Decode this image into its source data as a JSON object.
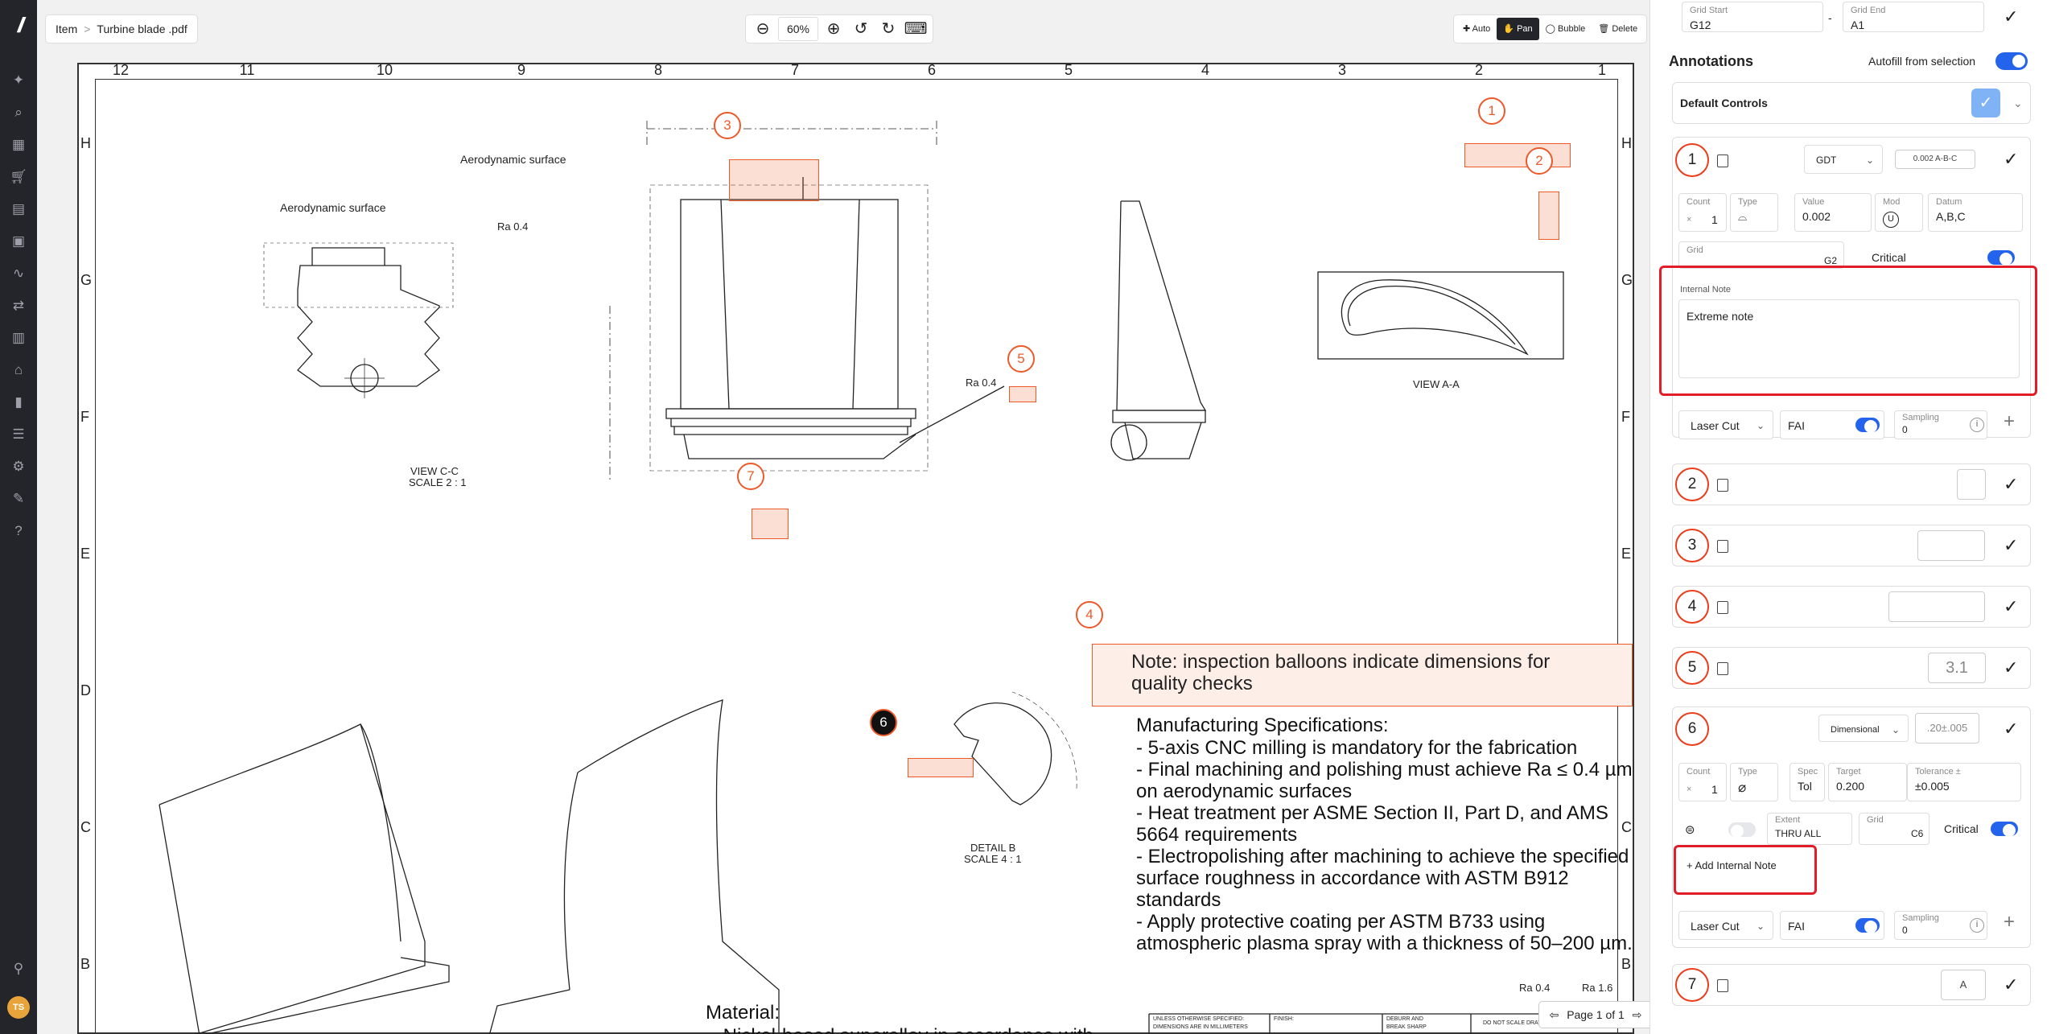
{
  "rail": {
    "logo": "//",
    "avatar": "TS"
  },
  "breadcrumb": {
    "root": "Item",
    "sep": ">",
    "file": "Turbine blade .pdf"
  },
  "zoom": {
    "value": "60%"
  },
  "modes": {
    "auto": "Auto",
    "pan": "Pan",
    "bubble": "Bubble",
    "delete": "Delete"
  },
  "drawing": {
    "grid_cols": [
      "12",
      "11",
      "10",
      "9",
      "8",
      "7",
      "6",
      "5",
      "4",
      "3",
      "2",
      "1"
    ],
    "grid_rows": [
      "H",
      "G",
      "F",
      "E",
      "D",
      "C",
      "B"
    ],
    "note": "Note: inspection balloons indicate dimensions for quality checks",
    "specs_title": "Manufacturing Specifications:",
    "specs": [
      "- 5-axis CNC milling is mandatory for the fabrication",
      "- Final machining and polishing must achieve Ra ≤ 0.4 µm on aerodynamic surfaces",
      "- Heat treatment per ASME Section II, Part D, and AMS 5664 requirements",
      "- Electropolishing after machining to achieve the specified surface roughness in accordance with ASTM B912 standards",
      "- Apply protective coating per ASTM B733 using atmospheric plasma spray with a thickness of 50–200 µm."
    ],
    "material_title": "Material:",
    "material_line": "- Nickel-based superalloy in accordance with",
    "labels": {
      "aero1": "Aerodynamic surface",
      "aero2": "Aerodynamic surface",
      "ra04": "Ra 0.4",
      "view_cc": "VIEW C-C",
      "scale21": "SCALE 2 : 1",
      "view_aa": "VIEW A-A",
      "detail_b": "DETAIL B",
      "scale41": "SCALE 4 : 1",
      "ra16": "Ra 1.6"
    },
    "titleblock": {
      "unless": "UNLESS OTHERWISE SPECIFIED:",
      "dims": "DIMENSIONS ARE IN MILLIMETERS",
      "finish": "FINISH:",
      "deburr": "DEBURR AND",
      "break": "BREAK SHARP",
      "noscale": "DO NOT SCALE DRAWING"
    },
    "balloons": [
      "1",
      "2",
      "3",
      "4",
      "5",
      "6",
      "7"
    ]
  },
  "pager": {
    "label": "Page 1 of 1"
  },
  "panel": {
    "grid_start_label": "Grid Start",
    "grid_start": "G12",
    "grid_end_label": "Grid End",
    "grid_end": "A1",
    "dash": "-",
    "annotations_title": "Annotations",
    "autofill_label": "Autofill from selection",
    "default_controls": "Default Controls",
    "a1": {
      "num": "1",
      "type_sel": "GDT",
      "chip": "0.002 A-B-C",
      "count_label": "Count",
      "count_prefix": "×",
      "count": "1",
      "type_label": "Type",
      "type_icon": "⌓",
      "value_label": "Value",
      "value": "0.002",
      "mod_label": "Mod",
      "mod": "U",
      "datum_label": "Datum",
      "datum": "A,B,C",
      "grid_label": "Grid",
      "grid": "G2",
      "critical": "Critical",
      "note_label": "Internal Note",
      "note": "Extreme note",
      "process": "Laser Cut",
      "fai": "FAI",
      "sampling_label": "Sampling",
      "sampling": "0"
    },
    "a2": {
      "num": "2"
    },
    "a3": {
      "num": "3"
    },
    "a4": {
      "num": "4"
    },
    "a5": {
      "num": "5",
      "chip": "3.1"
    },
    "a6": {
      "num": "6",
      "type_sel": "Dimensional",
      "chip": ".20±.005",
      "count_label": "Count",
      "count_prefix": "×",
      "count": "1",
      "type_label": "Type",
      "type_icon": "⌀",
      "spec_label": "Spec",
      "spec": "Tol",
      "target_label": "Target",
      "target": "0.200",
      "tol_label": "Tolerance ±",
      "tol": "±0.005",
      "extent_label": "Extent",
      "extent": "THRU ALL",
      "grid_label": "Grid",
      "grid": "C6",
      "critical": "Critical",
      "add_note": "Add Internal Note",
      "process": "Laser Cut",
      "fai": "FAI",
      "sampling_label": "Sampling",
      "sampling": "0"
    },
    "a7": {
      "num": "7",
      "chip": "A"
    }
  },
  "colors": {
    "accent": "#2463eb",
    "balloon": "#ec5a2a",
    "highlight_border": "#e11d2a"
  }
}
